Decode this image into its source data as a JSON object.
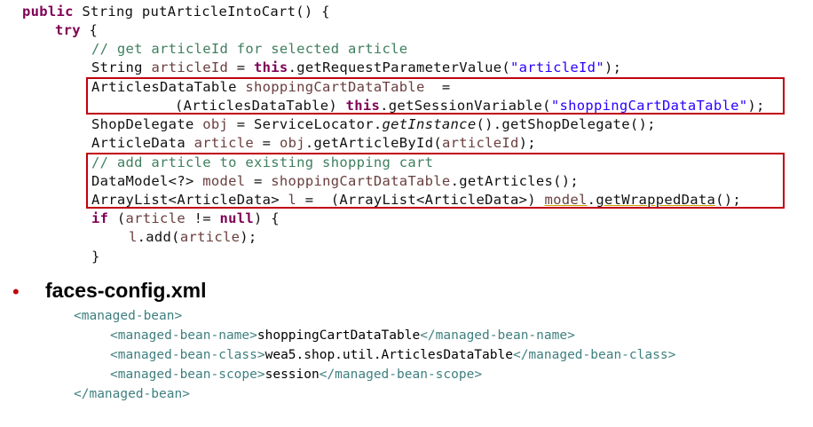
{
  "code": {
    "l1": [
      "public",
      " String putArticleIntoCart() {"
    ],
    "l2": [
      "try",
      " {"
    ],
    "l3": "// get articleId for selected article",
    "l4": [
      "String ",
      "articleId",
      " = ",
      "this",
      ".getRequestParameterValue(",
      "\"articleId\"",
      ");"
    ],
    "l5": [
      "ArticlesDataTable ",
      "shoppingCartDataTable",
      "  ="
    ],
    "l6": [
      "(ArticlesDataTable) ",
      "this",
      ".getSessionVariable(",
      "\"shoppingCartDataTable\"",
      ");"
    ],
    "l7": [
      "ShopDelegate ",
      "obj",
      " = ServiceLocator.",
      "getInstance",
      "().getShopDelegate();"
    ],
    "l8": [
      "ArticleData ",
      "article",
      " = ",
      "obj",
      ".getArticleById(",
      "articleId",
      ");"
    ],
    "l9": "// add article to existing shopping cart",
    "l10": [
      "DataModel<?> ",
      "model",
      " = ",
      "shoppingCartDataTable",
      ".getArticles();"
    ],
    "l11": [
      "ArrayList<ArticleData> ",
      "l",
      " =  (ArrayList<ArticleData>) ",
      "model",
      ".",
      "getWrappedData",
      "();"
    ],
    "l12": [
      "if",
      " (",
      "article",
      " != ",
      "null",
      ") {"
    ],
    "l13": [
      "l",
      ".add(",
      "article",
      ");"
    ],
    "l14": "}"
  },
  "section": {
    "bullet": "•",
    "title": "faces-config.xml"
  },
  "xml": {
    "open": "<managed-bean>",
    "name_open": "<managed-bean-name>",
    "name_value": "shoppingCartDataTable",
    "name_close": "</managed-bean-name>",
    "class_open": "<managed-bean-class>",
    "class_value": "wea5.shop.util.ArticlesDataTable",
    "class_close": "</managed-bean-class>",
    "scope_open": "<managed-bean-scope>",
    "scope_value": "session",
    "scope_close": "</managed-bean-scope>",
    "close": "</managed-bean>"
  },
  "colors": {
    "keyword": "#7f0055",
    "comment": "#3f7f5f",
    "string": "#2a00ff",
    "field": "#6a3e3e",
    "highlight_box": "#c0000b",
    "xml_tag": "#3f7f7f"
  }
}
